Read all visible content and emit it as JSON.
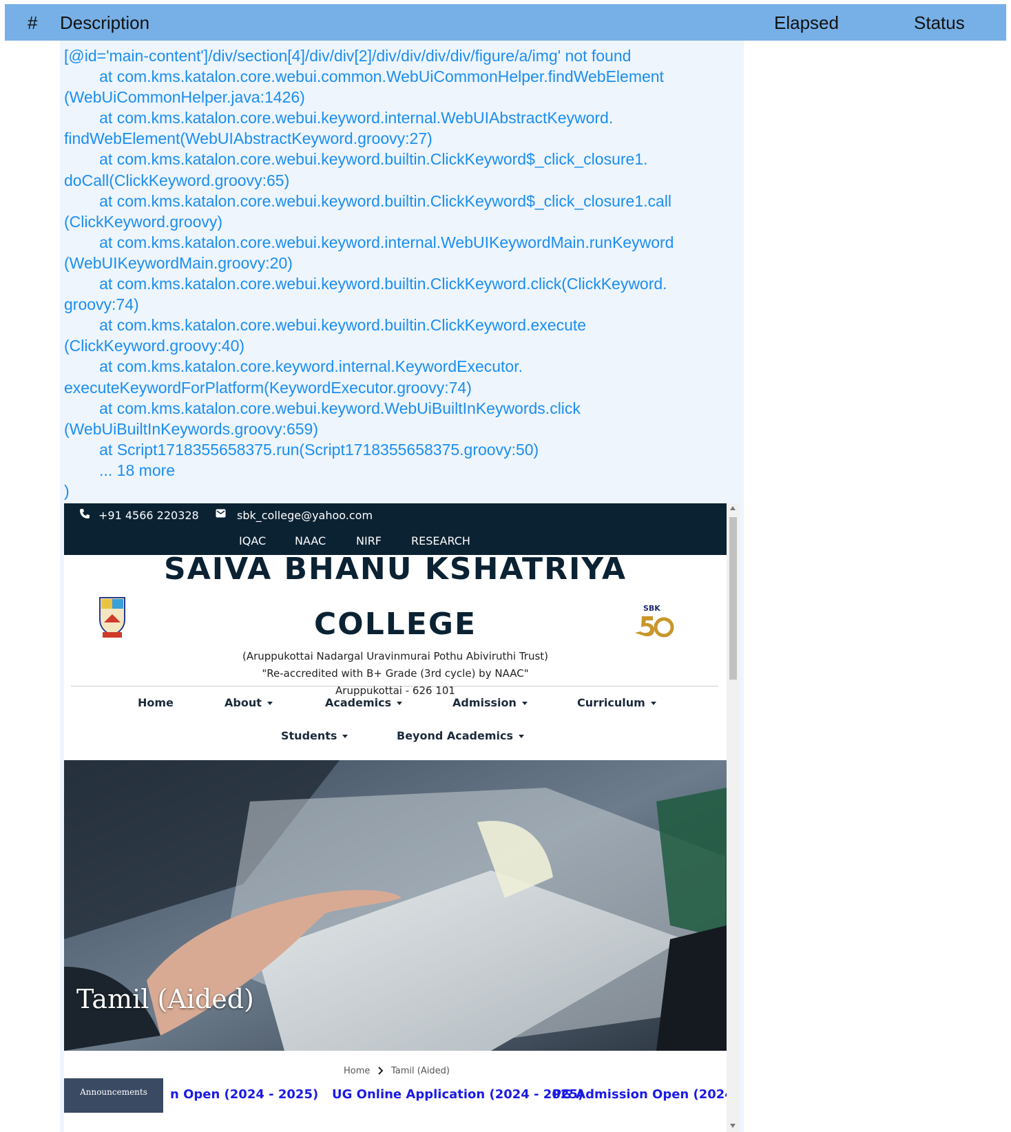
{
  "table_header": {
    "hash": "#",
    "description": "Description",
    "elapsed": "Elapsed",
    "status": "Status"
  },
  "error_trace": "[@id='main-content']/div/section[4]/div/div[2]/div/div/div/div/figure/a/img' not found\n\tat com.kms.katalon.core.webui.common.WebUiCommonHelper.findWebElement\n(WebUiCommonHelper.java:1426)\n\tat com.kms.katalon.core.webui.keyword.internal.WebUIAbstractKeyword.\nfindWebElement(WebUIAbstractKeyword.groovy:27)\n\tat com.kms.katalon.core.webui.keyword.builtin.ClickKeyword$_click_closure1.\ndoCall(ClickKeyword.groovy:65)\n\tat com.kms.katalon.core.webui.keyword.builtin.ClickKeyword$_click_closure1.call\n(ClickKeyword.groovy)\n\tat com.kms.katalon.core.webui.keyword.internal.WebUIKeywordMain.runKeyword\n(WebUIKeywordMain.groovy:20)\n\tat com.kms.katalon.core.webui.keyword.builtin.ClickKeyword.click(ClickKeyword.\ngroovy:74)\n\tat com.kms.katalon.core.webui.keyword.builtin.ClickKeyword.execute\n(ClickKeyword.groovy:40)\n\tat com.kms.katalon.core.keyword.internal.KeywordExecutor.\nexecuteKeywordForPlatform(KeywordExecutor.groovy:74)\n\tat com.kms.katalon.core.webui.keyword.WebUiBuiltInKeywords.click\n(WebUiBuiltInKeywords.groovy:659)\n\tat Script1718355658375.run(Script1718355658375.groovy:50)\n\t... 18 more\n)",
  "screenshot": {
    "phone": "+91 4566 220328",
    "email": "sbk_college@yahoo.com",
    "top_links": [
      "IQAC",
      "NAAC",
      "NIRF",
      "RESEARCH"
    ],
    "title_line1": "SAIVA BHANU KSHATRIYA",
    "title_line2": "COLLEGE",
    "trust": "(Aruppukottai Nadargal Uravinmurai Pothu Abiviruthi Trust)",
    "accreditation": "\"Re-accredited with B+ Grade (3rd cycle) by NAAC\"",
    "address": "Aruppukottai - 626 101",
    "logo_right_text": "SBK",
    "nav": {
      "home": "Home",
      "about": "About",
      "academics": "Academics",
      "admission": "Admission",
      "curriculum": "Curriculum",
      "students": "Students",
      "beyond": "Beyond Academics"
    },
    "hero_title": "Tamil (Aided)",
    "breadcrumb_home": "Home",
    "breadcrumb_current": "Tamil (Aided)",
    "announcements_label": "Announcements",
    "marquee": [
      "n Open (2024 - 2025)",
      "UG Online Application (2024 - 2025)",
      "PG Admission Open (2024 -"
    ]
  },
  "colors": {
    "header_bg": "#77b0e6",
    "trace_text": "#1a8ef0",
    "description_bg": "#eef5fd",
    "site_topbar": "#0b2233",
    "marquee_link": "#1a1ae6"
  }
}
